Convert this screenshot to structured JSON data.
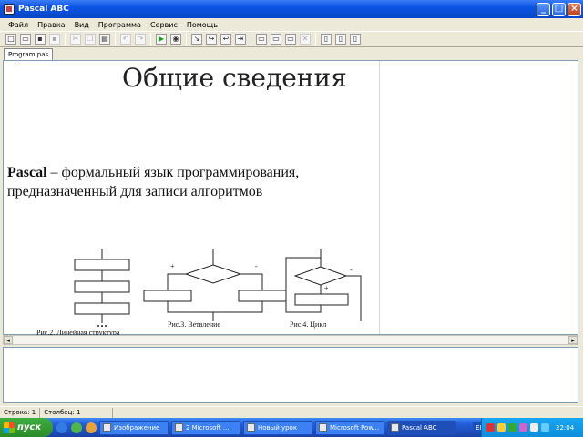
{
  "window": {
    "title": "Pascal ABC"
  },
  "window_buttons": {
    "minimize": "_",
    "maximize": "□",
    "close": "×"
  },
  "menu": [
    "Файл",
    "Правка",
    "Вид",
    "Программа",
    "Сервис",
    "Помощь"
  ],
  "tab": {
    "label": "Program.pas"
  },
  "slide": {
    "title": "Общие сведения",
    "text_bold": "Pascal",
    "text_rest": " – формальный язык программирования, предназначенный для записи алгоритмов",
    "captions": [
      "Рис.2. Линейная структура",
      "Рис.3. Ветвление",
      "Рис.4. Цикл"
    ],
    "plus": "+",
    "minus": "-"
  },
  "statusbar": {
    "cell1": "Строка: 1",
    "cell2": "Столбец: 1"
  },
  "taskbar": {
    "start": "пуск",
    "items": [
      {
        "label": "Изображение",
        "active": false
      },
      {
        "label": "2 Microsoft ...",
        "active": false
      },
      {
        "label": "Новый урок",
        "active": false
      },
      {
        "label": "Microsoft Pow...",
        "active": false
      },
      {
        "label": "Pascal ABC",
        "active": true
      }
    ],
    "lang": "EN",
    "clock": "22:04"
  },
  "colors": {
    "title_bar": "#0a55e4",
    "taskbar": "#245edb",
    "start": "#3fae3f"
  }
}
